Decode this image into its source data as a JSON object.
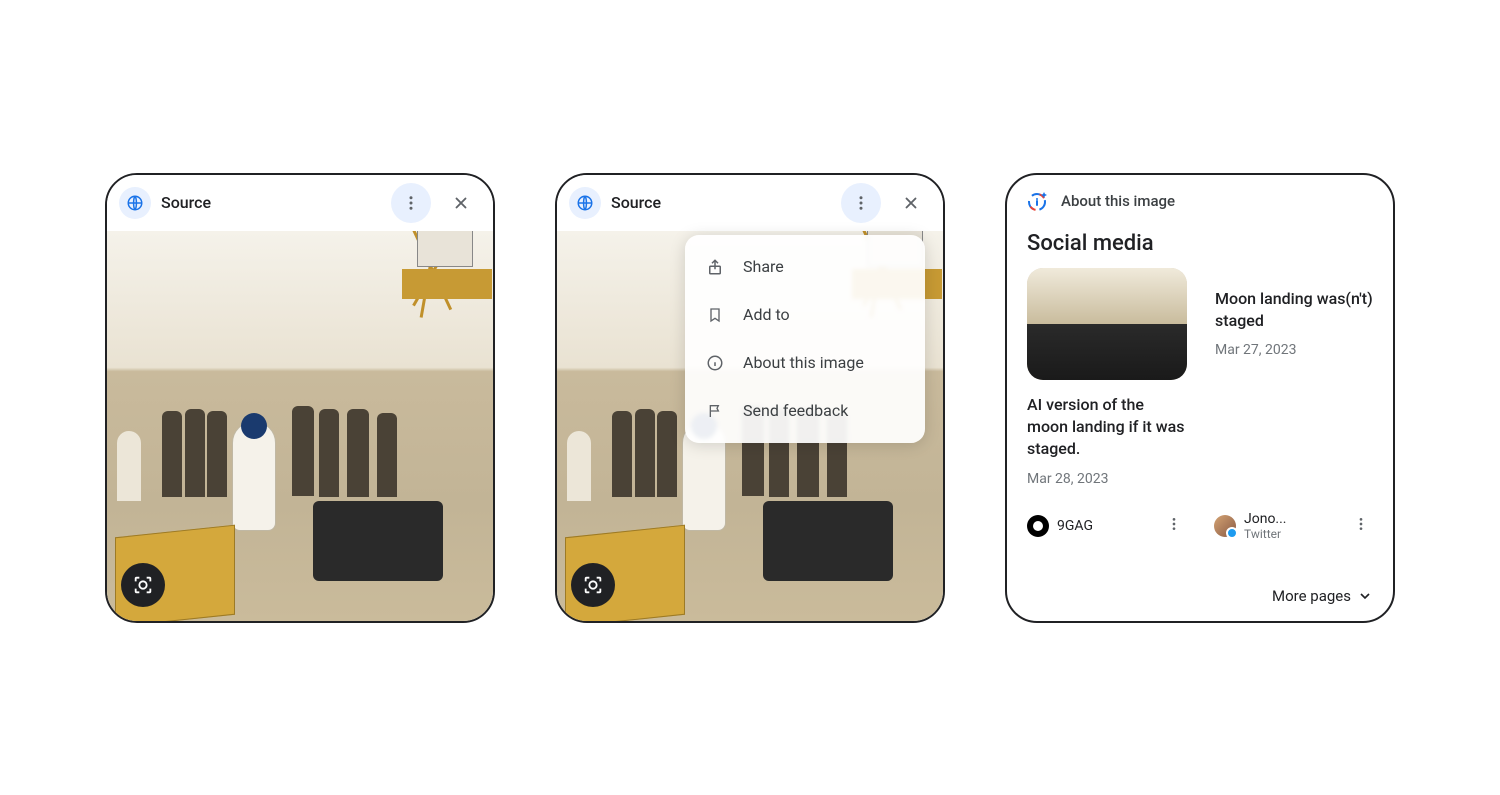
{
  "panel1": {
    "source_label": "Source"
  },
  "panel2": {
    "source_label": "Source",
    "menu": {
      "share": "Share",
      "add_to": "Add to",
      "about": "About this image",
      "feedback": "Send feedback"
    }
  },
  "panel3": {
    "header_title": "About this image",
    "section_title": "Social media",
    "results": [
      {
        "title": "AI version of the moon landing if it was staged.",
        "date": "Mar 28, 2023",
        "source_name": "9GAG"
      },
      {
        "title": "Moon landing was(n't) staged",
        "date": "Mar 27, 2023",
        "source_name": "Jono...",
        "source_sub": "Twitter"
      }
    ],
    "more_pages": "More pages"
  }
}
